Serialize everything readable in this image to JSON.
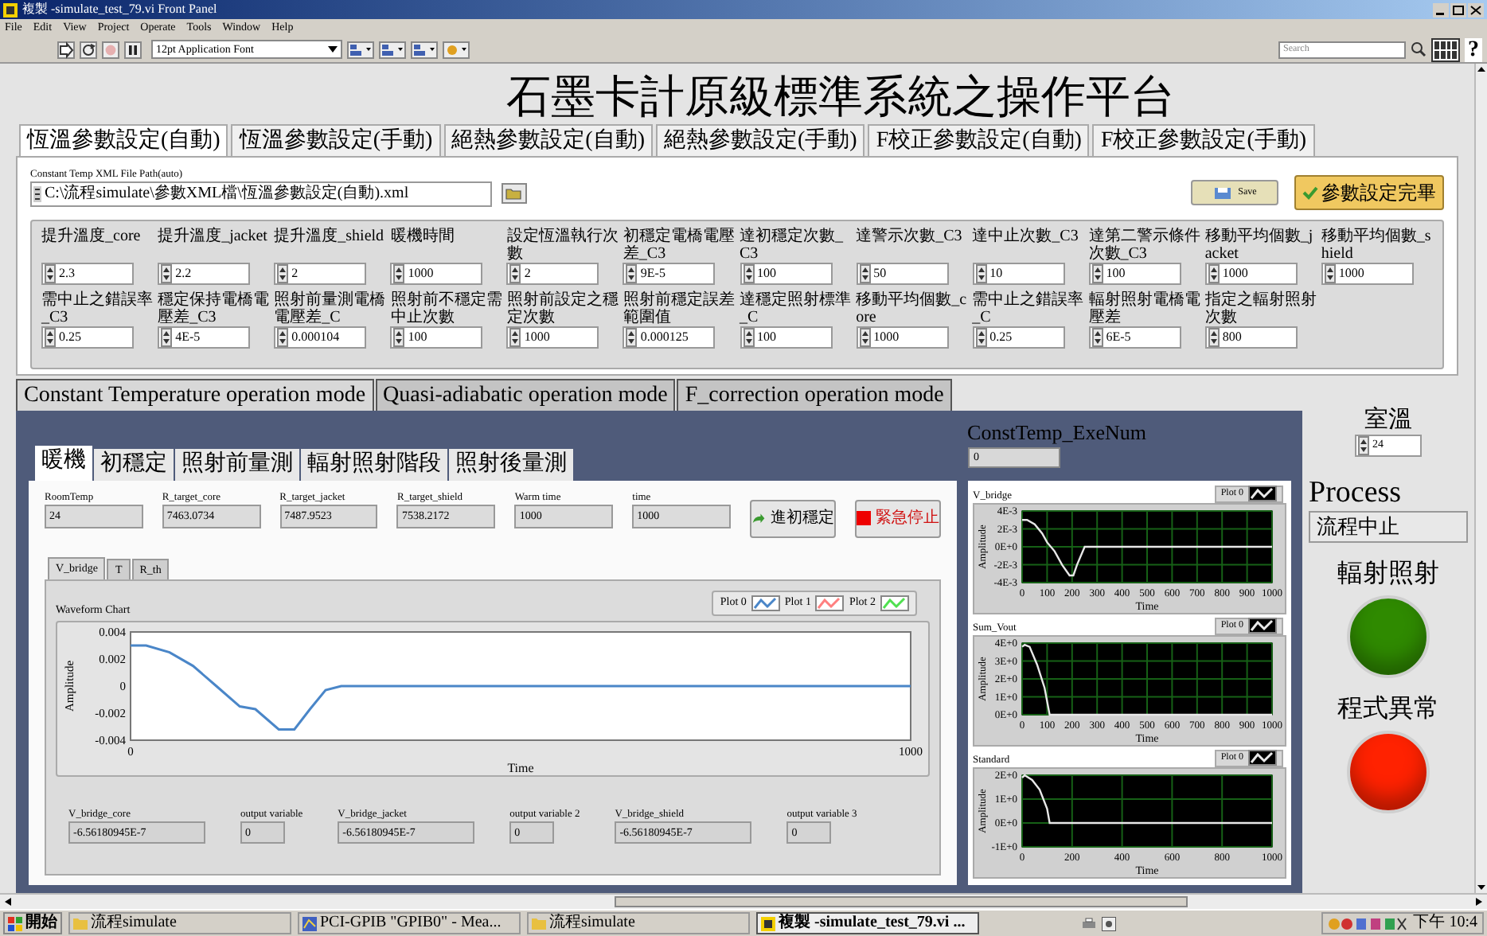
{
  "window": {
    "title": "複製 -simulate_test_79.vi Front Panel"
  },
  "menu": [
    "File",
    "Edit",
    "View",
    "Project",
    "Operate",
    "Tools",
    "Window",
    "Help"
  ],
  "toolbar": {
    "font": "12pt Application Font",
    "search": {
      "placeholder": "Search"
    },
    "help": "?"
  },
  "heading": "石墨卡計原級標準系統之操作平台",
  "tabs": [
    {
      "label": "恆溫參數設定(自動)",
      "selected": true
    },
    {
      "label": "恆溫參數設定(手動)",
      "selected": false
    },
    {
      "label": "絕熱參數設定(自動)",
      "selected": false
    },
    {
      "label": "絕熱參數設定(手動)",
      "selected": false
    },
    {
      "label": "F校正參數設定(自動)",
      "selected": false
    },
    {
      "label": "F校正參數設定(手動)",
      "selected": false
    }
  ],
  "file_path": {
    "label": "Constant Temp XML File Path(auto)",
    "value": "C:\\流程simulate\\參數XML檔\\恆溫參數設定(自動).xml"
  },
  "save_button": "Save",
  "done_button": "參數設定完畢",
  "parameters": [
    {
      "label": "提升溫度_core",
      "value": "2.3"
    },
    {
      "label": "提升溫度_jacket",
      "value": "2.2"
    },
    {
      "label": "提升溫度_shield",
      "value": "2"
    },
    {
      "label": "暖機時間",
      "value": "1000"
    },
    {
      "label": "設定恆溫執行次數",
      "value": "2"
    },
    {
      "label": "初穩定電橋電壓差_C3",
      "value": "9E-5"
    },
    {
      "label": "達初穩定次數_C3",
      "value": "100"
    },
    {
      "label": "達警示次數_C3",
      "value": "50"
    },
    {
      "label": "達中止次數_C3",
      "value": "10"
    },
    {
      "label": "達第二警示條件次數_C3",
      "value": "100"
    },
    {
      "label": "移動平均個數_jacket",
      "value": "1000"
    },
    {
      "label": "移動平均個數_shield",
      "value": "1000"
    },
    {
      "label": "需中止之錯誤率_C3",
      "value": "0.25"
    },
    {
      "label": "穩定保持電橋電壓差_C3",
      "value": "4E-5"
    },
    {
      "label": "照射前量測電橋電壓差_C",
      "value": "0.000104"
    },
    {
      "label": "照射前不穩定需中止次數",
      "value": "100"
    },
    {
      "label": "照射前設定之穩定次數",
      "value": "1000"
    },
    {
      "label": "照射前穩定誤差範圍值",
      "value": "0.000125"
    },
    {
      "label": "達穩定照射標準_C",
      "value": "100"
    },
    {
      "label": "移動平均個數_core",
      "value": "1000"
    },
    {
      "label": "需中止之錯誤率_C",
      "value": "0.25"
    },
    {
      "label": "輻射照射電橋電壓差",
      "value": "6E-5"
    },
    {
      "label": "指定之輻射照射次數",
      "value": "800"
    }
  ],
  "mode_tabs": [
    {
      "label": "Constant Temperature operation mode",
      "selected": true
    },
    {
      "label": "Quasi-adiabatic operation mode",
      "selected": false
    },
    {
      "label": "F_correction operation mode",
      "selected": false
    }
  ],
  "exe_num": {
    "label": "ConstTemp_ExeNum",
    "value": "0"
  },
  "stage_tabs": [
    {
      "label": "暖機",
      "selected": true
    },
    {
      "label": "初穩定",
      "selected": false
    },
    {
      "label": "照射前量測",
      "selected": false
    },
    {
      "label": "輻射照射階段",
      "selected": false
    },
    {
      "label": "照射後量測",
      "selected": false
    }
  ],
  "readings": [
    {
      "label": "RoomTemp",
      "value": "24"
    },
    {
      "label": "R_target_core",
      "value": "7463.0734"
    },
    {
      "label": "R_target_jacket",
      "value": "7487.9523"
    },
    {
      "label": "R_target_shield",
      "value": "7538.2172"
    },
    {
      "label": "Warm time",
      "value": "1000"
    },
    {
      "label": "time",
      "value": "1000"
    }
  ],
  "buttons": [
    {
      "label": "進初穩定",
      "kind": "arrow"
    },
    {
      "label": "緊急停止",
      "kind": "stop"
    }
  ],
  "sub_tabs": [
    {
      "label": "V_bridge",
      "selected": true
    },
    {
      "label": "T",
      "selected": false
    },
    {
      "label": "R_th",
      "selected": false
    }
  ],
  "waveform_chart": {
    "chart_data": {
      "type": "line",
      "title": "Waveform Chart",
      "xlabel": "Time",
      "ylabel": "Amplitude",
      "x": [
        0,
        20,
        50,
        80,
        110,
        140,
        160,
        190,
        210,
        230,
        250,
        270,
        400,
        600,
        800,
        1000
      ],
      "series": [
        {
          "name": "Plot 0",
          "color": "#4a86c8",
          "values": [
            0.003,
            0.003,
            0.0025,
            0.0015,
            0,
            -0.0015,
            -0.0017,
            -0.0032,
            -0.0032,
            -0.0017,
            -0.0003,
            0,
            0,
            0,
            0,
            0
          ]
        },
        {
          "name": "Plot 1",
          "color": "#ff8080",
          "values": [
            null,
            null,
            null,
            null,
            null,
            null,
            null,
            null,
            null,
            null,
            null,
            null,
            null,
            null,
            null,
            null
          ]
        },
        {
          "name": "Plot 2",
          "color": "#50e050",
          "values": [
            null,
            null,
            null,
            null,
            null,
            null,
            null,
            null,
            null,
            null,
            null,
            null,
            null,
            null,
            null,
            null
          ]
        }
      ],
      "xlim": [
        0,
        1000
      ],
      "ylim": [
        -0.004,
        0.004
      ],
      "xticks": [
        0,
        1000
      ],
      "yticks": [
        -0.004,
        -0.002,
        0,
        0.002,
        0.004
      ]
    }
  },
  "outputs": [
    {
      "label": "V_bridge_core",
      "value": "-6.56180945E-7",
      "kind": "wide"
    },
    {
      "label": "output variable",
      "value": "0",
      "kind": "narrow"
    },
    {
      "label": "V_bridge_jacket",
      "value": "-6.56180945E-7",
      "kind": "wide"
    },
    {
      "label": "output variable 2",
      "value": "0",
      "kind": "narrow"
    },
    {
      "label": "V_bridge_shield",
      "value": "-6.56180945E-7",
      "kind": "wide"
    },
    {
      "label": "output variable 3",
      "value": "0",
      "kind": "narrow"
    }
  ],
  "small_charts": [
    {
      "chart_data": {
        "type": "line",
        "grid": true,
        "title": "V_bridge",
        "xlabel": "Time",
        "ylabel": "Amplitude",
        "x": [
          0,
          20,
          50,
          80,
          100,
          130,
          160,
          190,
          205,
          220,
          250,
          1000
        ],
        "series": [
          {
            "name": "Plot 0",
            "color": "#e8e8e8",
            "values": [
              0.003,
              0.003,
              0.0025,
              0.0015,
              0.0005,
              -0.0005,
              -0.002,
              -0.0032,
              -0.0032,
              -0.002,
              0,
              0
            ]
          }
        ],
        "xlim": [
          0,
          1000
        ],
        "ylim": [
          -0.004,
          0.004
        ],
        "xticks": [
          0,
          100,
          200,
          300,
          400,
          500,
          600,
          700,
          800,
          900,
          1000
        ],
        "yticks": [
          {
            "value": -0.004,
            "label": "-4E-3"
          },
          {
            "value": -0.002,
            "label": "-2E-3"
          },
          {
            "value": 0,
            "label": "0E+0"
          },
          {
            "value": 0.002,
            "label": "2E-3"
          },
          {
            "value": 0.004,
            "label": "4E-3"
          }
        ]
      }
    },
    {
      "chart_data": {
        "type": "line",
        "grid": true,
        "title": "Sum_Vout",
        "xlabel": "Time",
        "ylabel": "Amplitude",
        "x": [
          0,
          10,
          30,
          60,
          90,
          110,
          1000
        ],
        "series": [
          {
            "name": "Plot 0",
            "color": "#e8e8e8",
            "values": [
              3.8,
              3.9,
              3.8,
              2.8,
              1.5,
              0,
              0
            ]
          }
        ],
        "xlim": [
          0,
          1000
        ],
        "ylim": [
          0,
          4
        ],
        "xticks": [
          0,
          100,
          200,
          300,
          400,
          500,
          600,
          700,
          800,
          900,
          1000
        ],
        "yticks": [
          {
            "value": 0,
            "label": "0E+0"
          },
          {
            "value": 1,
            "label": "1E+0"
          },
          {
            "value": 2,
            "label": "2E+0"
          },
          {
            "value": 3,
            "label": "3E+0"
          },
          {
            "value": 4,
            "label": "4E+0"
          }
        ]
      }
    },
    {
      "chart_data": {
        "type": "line",
        "grid": true,
        "title": "Standard",
        "xlabel": "Time",
        "ylabel": "Amplitude",
        "x": [
          0,
          10,
          40,
          70,
          100,
          110,
          1000
        ],
        "series": [
          {
            "name": "Plot 0",
            "color": "#e8e8e8",
            "values": [
              1.9,
              2,
              1.8,
              1.4,
              0.6,
              0,
              0
            ]
          }
        ],
        "xlim": [
          0,
          1000
        ],
        "ylim": [
          -1,
          2
        ],
        "xticks": [
          0,
          200,
          400,
          600,
          800,
          1000
        ],
        "yticks": [
          {
            "value": -1,
            "label": "-1E+0"
          },
          {
            "value": 0,
            "label": "0E+0"
          },
          {
            "value": 1,
            "label": "1E+0"
          },
          {
            "value": 2,
            "label": "2E+0"
          }
        ]
      }
    }
  ],
  "room_temp": {
    "label": "室溫",
    "value": "24"
  },
  "process": {
    "label": "Process",
    "value": "流程中止"
  },
  "lamps": [
    {
      "label": "輻射照射",
      "color": "#2f8a00"
    },
    {
      "label": "程式異常",
      "color": "#ff2200"
    }
  ],
  "taskbar": {
    "start": "開始",
    "items": [
      {
        "label": "流程simulate",
        "kind": "folder",
        "selected": false
      },
      {
        "label": "PCI-GPIB \"GPIB0\" - Mea...",
        "kind": "app",
        "selected": false
      },
      {
        "label": "流程simulate",
        "kind": "folder",
        "selected": false
      },
      {
        "label": "複製 -simulate_test_79.vi ...",
        "kind": "vi",
        "selected": true
      }
    ],
    "clock": "下午 10:4"
  }
}
